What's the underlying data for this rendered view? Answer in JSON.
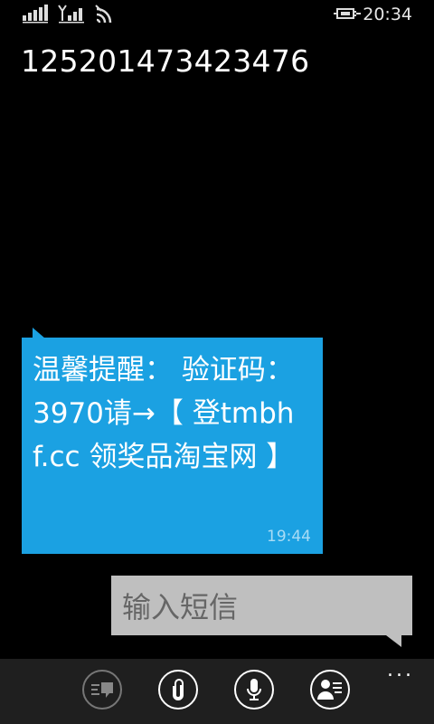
{
  "status_bar": {
    "time": "20:34",
    "icons": [
      "signal-bars-icon",
      "signal-bars-antenna-icon",
      "wifi-icon",
      "battery-charging-icon"
    ]
  },
  "thread": {
    "title": "125201473423476"
  },
  "messages": [
    {
      "direction": "incoming",
      "text": "温馨提醒： 验证码：3970请→【 登tmbhf.cc 领奖品淘宝网 】",
      "time": "19:44"
    }
  ],
  "compose": {
    "placeholder": "输入短信"
  },
  "app_bar": {
    "buttons": [
      {
        "icon": "conversations-icon",
        "enabled": false
      },
      {
        "icon": "attach-icon",
        "enabled": true
      },
      {
        "icon": "microphone-icon",
        "enabled": true
      },
      {
        "icon": "contact-card-icon",
        "enabled": true
      }
    ],
    "more": "..."
  },
  "colors": {
    "accent": "#1ba1e2",
    "compose_bg": "#bfbfbf",
    "app_bar_bg": "#1f1f1f"
  }
}
